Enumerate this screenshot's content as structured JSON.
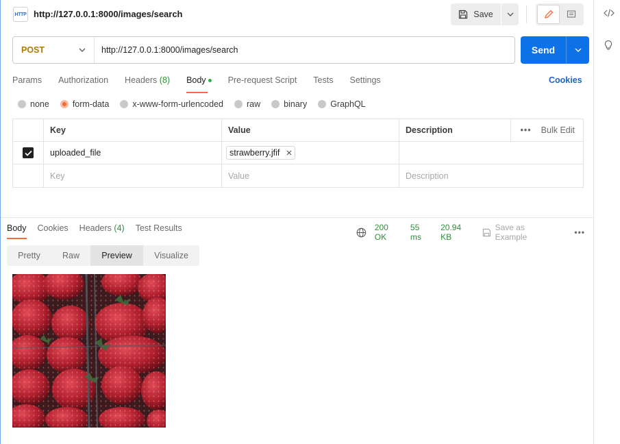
{
  "request": {
    "title": "http://127.0.0.1:8000/images/search",
    "method": "POST",
    "url": "http://127.0.0.1:8000/images/search",
    "save_label": "Save",
    "send_label": "Send",
    "http_badge": "HTTP"
  },
  "request_tabs": [
    {
      "label": "Params"
    },
    {
      "label": "Authorization"
    },
    {
      "label": "Headers",
      "count": "(8)"
    },
    {
      "label": "Body",
      "active": true
    },
    {
      "label": "Pre-request Script"
    },
    {
      "label": "Tests"
    },
    {
      "label": "Settings"
    }
  ],
  "cookies_label": "Cookies",
  "body_types": [
    {
      "label": "none"
    },
    {
      "label": "form-data",
      "selected": true
    },
    {
      "label": "x-www-form-urlencoded"
    },
    {
      "label": "raw"
    },
    {
      "label": "binary"
    },
    {
      "label": "GraphQL"
    }
  ],
  "form_table": {
    "headers": {
      "key": "Key",
      "value": "Value",
      "description": "Description",
      "bulk_edit": "Bulk Edit"
    },
    "rows": [
      {
        "checked": true,
        "key": "uploaded_file",
        "value": "strawberry.jfif",
        "description": ""
      }
    ],
    "placeholders": {
      "key": "Key",
      "value": "Value",
      "description": "Description"
    }
  },
  "response": {
    "tabs": [
      {
        "label": "Body",
        "active": true
      },
      {
        "label": "Cookies"
      },
      {
        "label": "Headers",
        "count": "(4)"
      },
      {
        "label": "Test Results"
      }
    ],
    "status": "200 OK",
    "time": "55 ms",
    "size": "20.94 KB",
    "save_example": "Save as Example",
    "view_tabs": [
      {
        "label": "Pretty"
      },
      {
        "label": "Raw"
      },
      {
        "label": "Preview",
        "active": true
      },
      {
        "label": "Visualize"
      }
    ]
  },
  "colors": {
    "accent": "#f26b3a",
    "send": "#0d72e8",
    "status_ok": "#2f8f3a",
    "method": "#ad7a03"
  }
}
